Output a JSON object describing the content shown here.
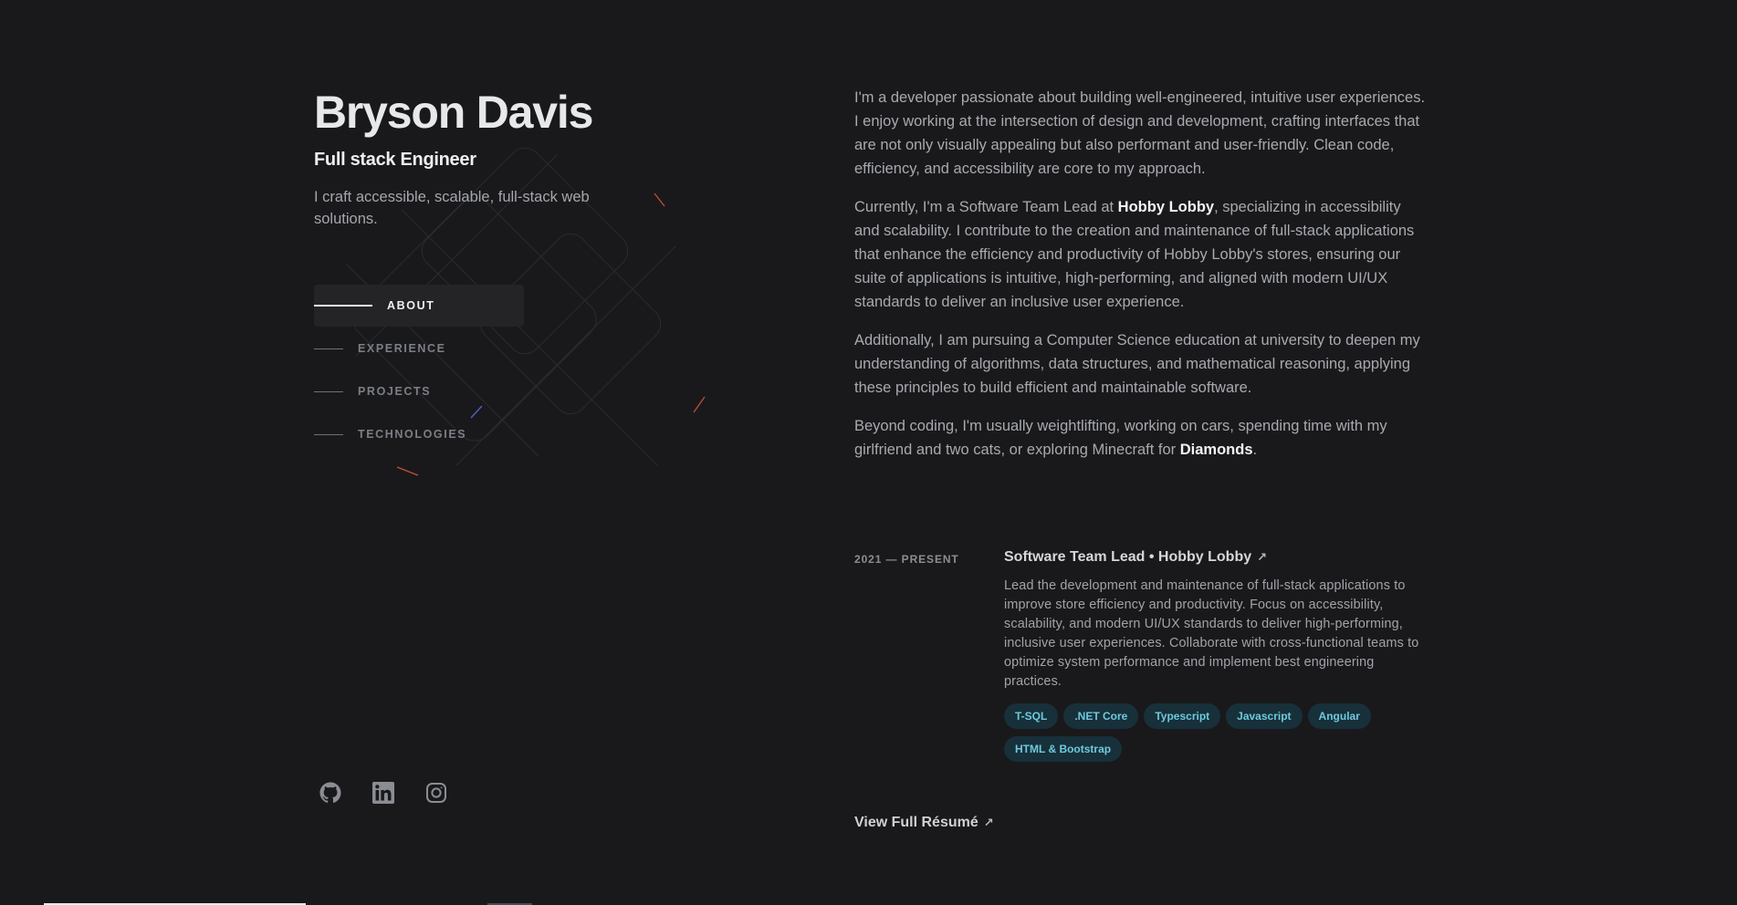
{
  "header": {
    "name": "Bryson Davis",
    "role": "Full stack Engineer",
    "tagline": "I craft accessible, scalable, full-stack web solutions."
  },
  "nav": {
    "items": [
      {
        "label": "ABOUT",
        "active": true
      },
      {
        "label": "EXPERIENCE",
        "active": false
      },
      {
        "label": "PROJECTS",
        "active": false
      },
      {
        "label": "TECHNOLOGIES",
        "active": false
      }
    ]
  },
  "socials": [
    {
      "icon": "github-icon"
    },
    {
      "icon": "linkedin-icon"
    },
    {
      "icon": "instagram-icon"
    }
  ],
  "about": {
    "p1": "I'm a developer passionate about building well-engineered, intuitive user experiences. I enjoy working at the intersection of design and development, crafting interfaces that are not only visually appealing but also performant and user-friendly. Clean code, efficiency, and accessibility are core to my approach.",
    "p2_pre": "Currently, I'm a Software Team Lead at ",
    "p2_strong": "Hobby Lobby",
    "p2_post": ", specializing in accessibility and scalability. I contribute to the creation and maintenance of full-stack applications that enhance the efficiency and productivity of Hobby Lobby's stores, ensuring our suite of applications is intuitive, high-performing, and aligned with modern UI/UX standards to deliver an inclusive user experience.",
    "p3": "Additionally, I am pursuing a Computer Science education at university to deepen my understanding of algorithms, data structures, and mathematical reasoning, applying these principles to build efficient and maintainable software.",
    "p4_pre": "Beyond coding, I'm usually weightlifting, working on cars, spending time with my girlfriend and two cats, or exploring Minecraft for ",
    "p4_strong": "Diamonds",
    "p4_post": "."
  },
  "experience": {
    "date": "2021 — PRESENT",
    "title": "Software Team Lead • Hobby Lobby",
    "arrow": "↗",
    "description": "Lead the development and maintenance of full-stack applications to improve store efficiency and productivity. Focus on accessibility, scalability, and modern UI/UX standards to deliver high-performing, inclusive user experiences. Collaborate with cross-functional teams to optimize system performance and implement best engineering practices.",
    "tags": [
      "T-SQL",
      ".NET Core",
      "Typescript",
      "Javascript",
      "Angular",
      "HTML & Bootstrap"
    ]
  },
  "resume": {
    "label": "View Full Résumé",
    "arrow": "↗"
  },
  "colors": {
    "background": "#19191b",
    "tag_bg": "#17303a",
    "tag_text": "#6ec9dd",
    "heading": "#e7e8ea"
  }
}
